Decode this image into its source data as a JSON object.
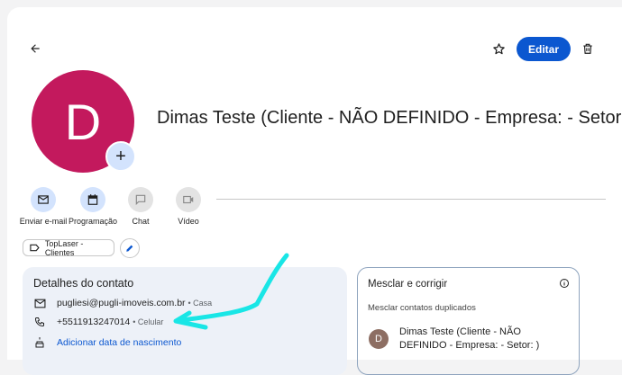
{
  "header": {
    "edit_label": "Editar"
  },
  "contact": {
    "initial": "D",
    "name": "Dimas Teste (Cliente - NÃO DEFINIDO - Empresa: - Setor: )"
  },
  "actions": [
    {
      "label": "Enviar e-mail",
      "icon": "mail-icon",
      "enabled": true
    },
    {
      "label": "Programação",
      "icon": "calendar-icon",
      "enabled": true
    },
    {
      "label": "Chat",
      "icon": "chat-icon",
      "enabled": false
    },
    {
      "label": "Vídeo",
      "icon": "video-icon",
      "enabled": false
    }
  ],
  "labels": [
    {
      "text": "TopLaser - Clientes"
    }
  ],
  "details": {
    "title": "Detalhes do contato",
    "email": "pugliesi@pugli-imoveis.com.br",
    "email_type": "• Casa",
    "phone": "+5511913247014",
    "phone_type": "• Celular",
    "birthday_link": "Adicionar data de nascimento"
  },
  "merge": {
    "title": "Mesclar e corrigir",
    "subtitle": "Mesclar contatos duplicados",
    "duplicate": {
      "initial": "D",
      "name": "Dimas Teste (Cliente - NÃO DEFINIDO - Empresa: - Setor: )"
    }
  },
  "annotation_color": "#19e6e6"
}
